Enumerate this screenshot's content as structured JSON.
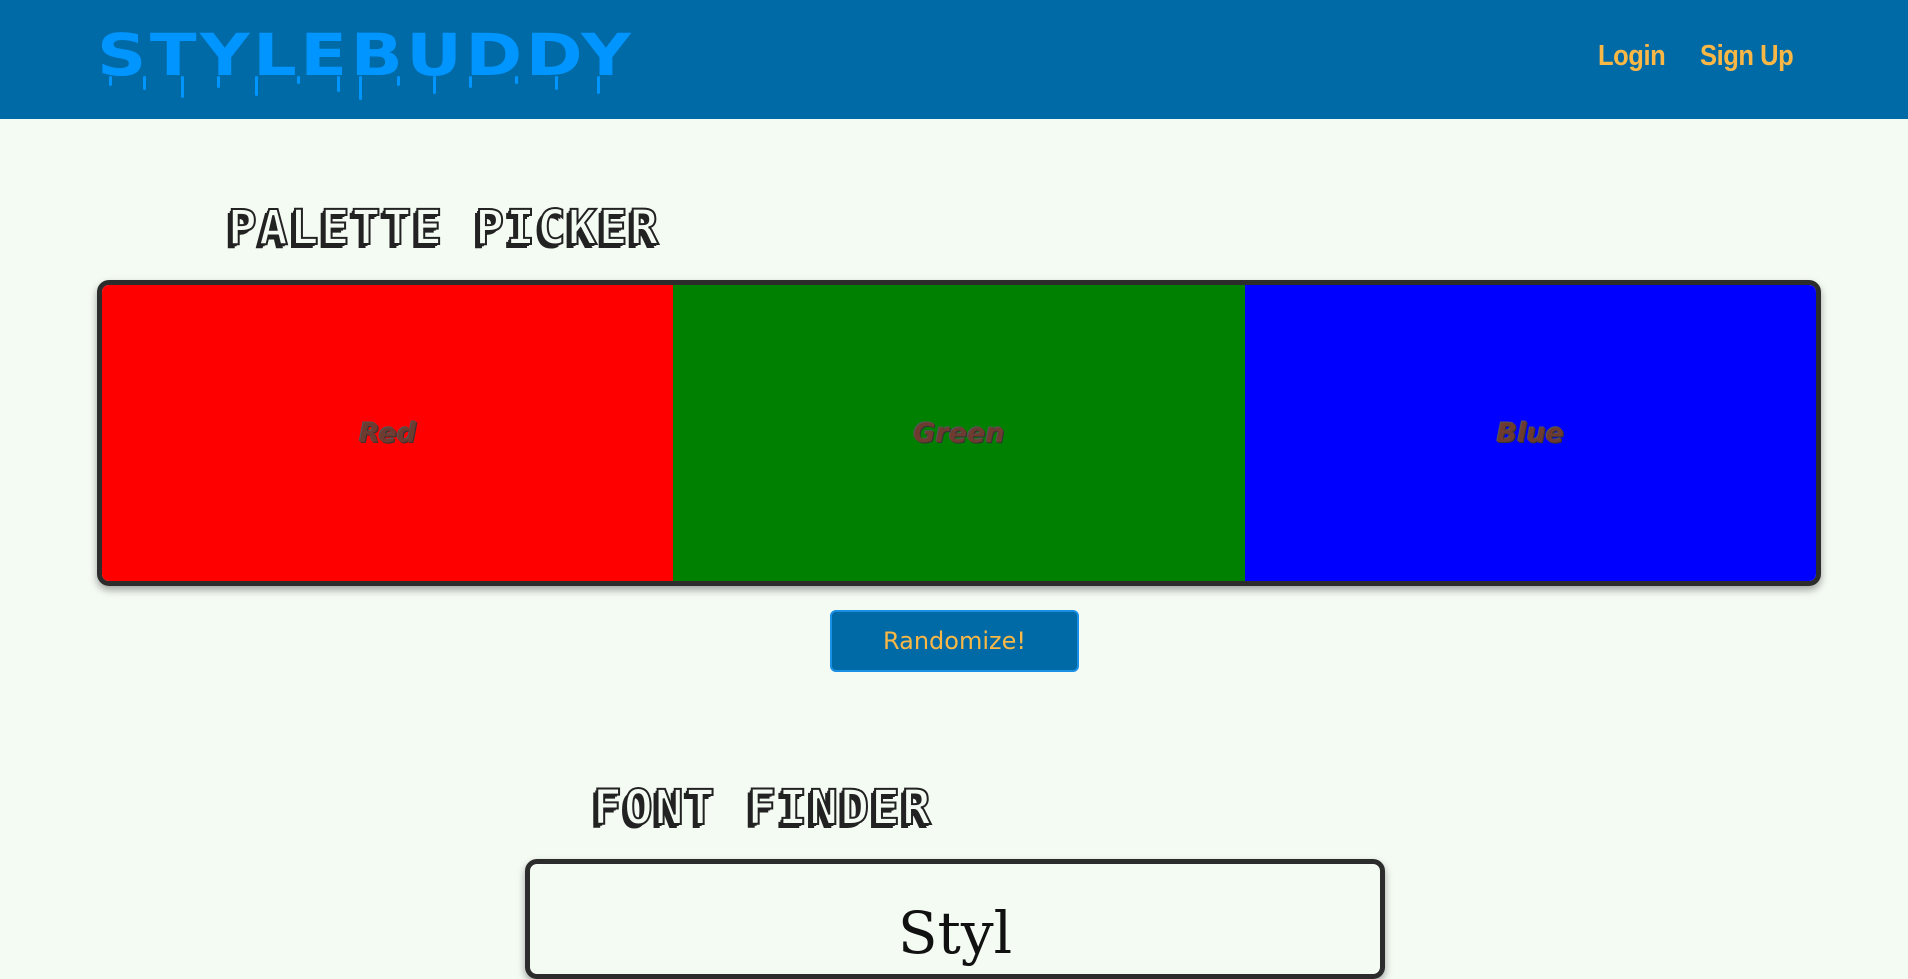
{
  "header": {
    "logo": "STYLEBUDDY",
    "nav": {
      "login": "Login",
      "signup": "Sign Up"
    }
  },
  "palette_picker": {
    "title": "PALETTE PICKER",
    "swatches": [
      {
        "label": "Red",
        "color": "#ff0000"
      },
      {
        "label": "Green",
        "color": "#008000"
      },
      {
        "label": "Blue",
        "color": "#0000ff"
      }
    ],
    "randomize_label": "Randomize!"
  },
  "font_finder": {
    "title": "FONT FINDER",
    "sample_text": "Styl"
  },
  "colors": {
    "header_bg": "#006aa6",
    "logo": "#0095ff",
    "nav_text": "#f9b846",
    "page_bg": "#f4fbf3"
  }
}
